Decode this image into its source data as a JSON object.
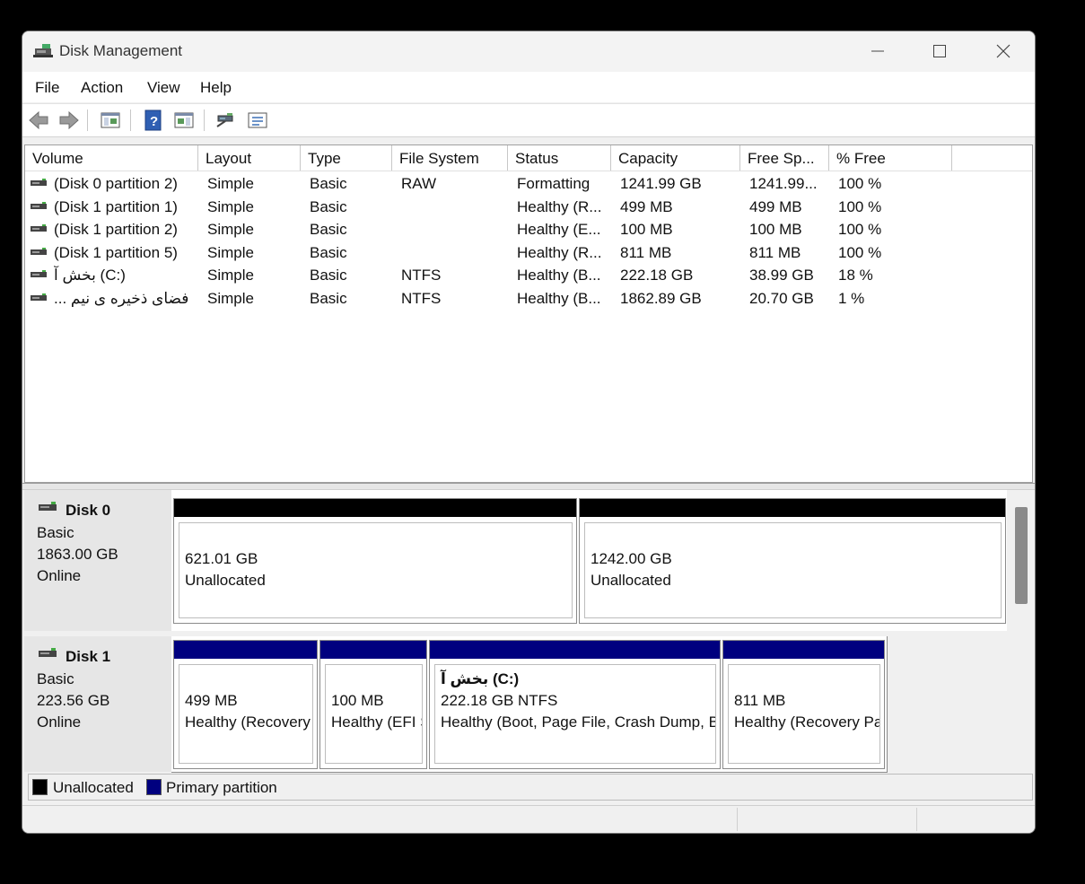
{
  "window": {
    "title": "Disk Management"
  },
  "menu": [
    "File",
    "Action",
    "View",
    "Help"
  ],
  "toolbar": [
    "back-icon",
    "forward-icon",
    "console-tree-icon",
    "help-icon",
    "action-pane-icon",
    "connect-icon",
    "properties-icon"
  ],
  "volume_list": {
    "columns": [
      "Volume",
      "Layout",
      "Type",
      "File System",
      "Status",
      "Capacity",
      "Free Sp...",
      "% Free"
    ],
    "rows": [
      [
        "(Disk 0 partition 2)",
        "Simple",
        "Basic",
        "RAW",
        "Formatting",
        "1241.99 GB",
        "1241.99...",
        "100 %"
      ],
      [
        "(Disk 1 partition 1)",
        "Simple",
        "Basic",
        "",
        "Healthy (R...",
        "499 MB",
        "499 MB",
        "100 %"
      ],
      [
        "(Disk 1 partition 2)",
        "Simple",
        "Basic",
        "",
        "Healthy (E...",
        "100 MB",
        "100 MB",
        "100 %"
      ],
      [
        "(Disk 1 partition 5)",
        "Simple",
        "Basic",
        "",
        "Healthy (R...",
        "811 MB",
        "811 MB",
        "100 %"
      ],
      [
        "‎بخش آ (C:)",
        "Simple",
        "Basic",
        "NTFS",
        "Healthy (B...",
        "222.18 GB",
        "38.99 GB",
        "18 %"
      ],
      [
        "‎... فضای ذخیره ی نیم",
        "Simple",
        "Basic",
        "NTFS",
        "Healthy (B...",
        "1862.89 GB",
        "20.70 GB",
        "1 %"
      ]
    ]
  },
  "disks": [
    {
      "name": "Disk 0",
      "type": "Basic",
      "size": "1863.00 GB",
      "state": "Online",
      "partitions": [
        {
          "lines": [
            "621.01 GB",
            "Unallocated"
          ]
        },
        {
          "lines": [
            "1242.00 GB",
            "Unallocated"
          ]
        }
      ]
    },
    {
      "name": "Disk 1",
      "type": "Basic",
      "size": "223.56 GB",
      "state": "Online",
      "partitions": [
        {
          "lines": [
            "499 MB",
            "Healthy (Recovery Partition)"
          ]
        },
        {
          "lines": [
            "100 MB",
            "Healthy (EFI System Partition)"
          ]
        },
        {
          "title": "بخش آ  (C:)",
          "lines": [
            "222.18 GB NTFS",
            "Healthy (Boot, Page File, Crash Dump, Basic Data Partition)"
          ]
        },
        {
          "lines": [
            "811 MB",
            "Healthy (Recovery Partition)"
          ]
        }
      ]
    }
  ],
  "legend": [
    {
      "label": "Unallocated",
      "color": "#000000"
    },
    {
      "label": "Primary partition",
      "color": "#00007f"
    }
  ],
  "colors": {
    "unallocated": "#000000",
    "primary": "#00007f"
  }
}
